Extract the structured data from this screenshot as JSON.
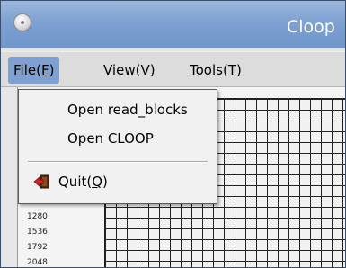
{
  "window": {
    "title": "Cloop"
  },
  "menubar": {
    "items": [
      {
        "label": "File(",
        "mnemonic": "F",
        "close": ")"
      },
      {
        "label": "View(",
        "mnemonic": "V",
        "close": ")"
      },
      {
        "label": "Tools(",
        "mnemonic": "T",
        "close": ")"
      }
    ]
  },
  "file_menu": {
    "open_read_blocks": "Open read_blocks",
    "open_cloop": "Open CLOOP",
    "quit": {
      "label": "Quit(",
      "mnemonic": "Q",
      "close": ")",
      "icon": "exit-door-icon"
    }
  },
  "rows": [
    "1280",
    "1536",
    "1792",
    "2048"
  ],
  "colors": {
    "titlebar": "#7ea1d1",
    "menu_highlight": "#7ea1d1",
    "grid_line": "#222222",
    "quit_icon_red": "#d82020"
  }
}
